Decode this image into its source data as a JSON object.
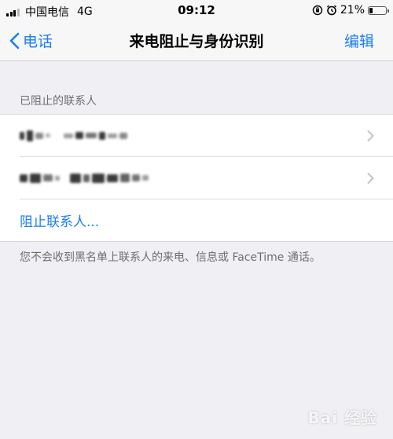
{
  "status_bar": {
    "carrier": "中国电信",
    "network": "4G",
    "time": "09:12",
    "battery": "21%",
    "battery_level": 0.21,
    "icons": [
      "screen-rotation-lock-icon",
      "alarm-icon"
    ]
  },
  "nav": {
    "back_label": "电话",
    "title": "来电阻止与身份识别",
    "edit_label": "编辑"
  },
  "blocked": {
    "section_header": "已阻止的联系人",
    "contacts": [
      {
        "name": "(blurred)"
      },
      {
        "name": "(blurred)"
      }
    ],
    "add_label": "阻止联系人..."
  },
  "footer_note": "您不会收到黑名单上联系人的来电、信息或 FaceTime 通话。",
  "watermark": "Bai 经验",
  "colors": {
    "accent": "#1a7ef6",
    "background": "#efeff4",
    "secondary_text": "#6d6d72"
  }
}
